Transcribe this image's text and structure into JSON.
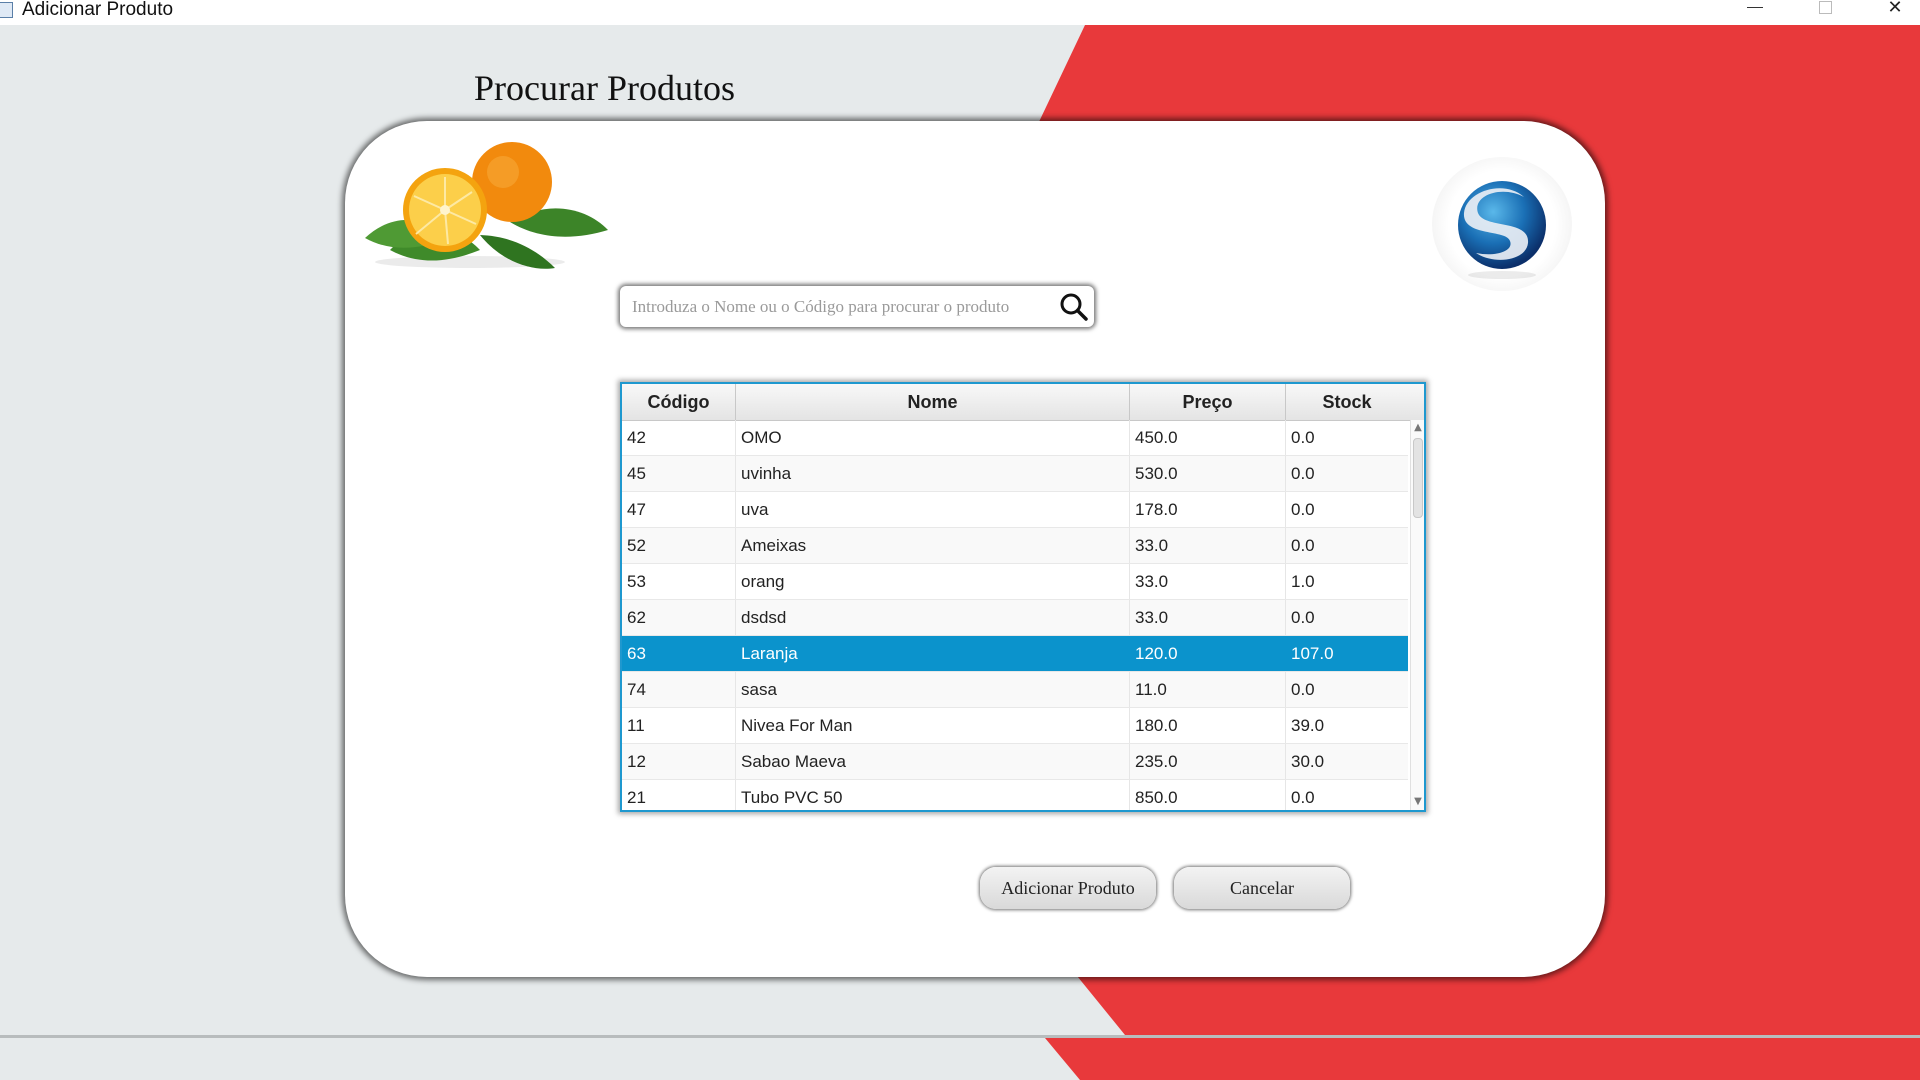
{
  "window": {
    "title": "Adicionar Produto"
  },
  "page": {
    "title": "Procurar Produtos"
  },
  "search": {
    "placeholder": "Introduza o Nome ou o Código para procurar o produto",
    "value": ""
  },
  "table": {
    "columns": [
      "Código",
      "Nome",
      "Preço",
      "Stock"
    ],
    "rows": [
      {
        "codigo": "42",
        "nome": "OMO",
        "preco": "450.0",
        "stock": "0.0"
      },
      {
        "codigo": "45",
        "nome": "uvinha",
        "preco": "530.0",
        "stock": "0.0"
      },
      {
        "codigo": "47",
        "nome": "uva",
        "preco": "178.0",
        "stock": "0.0"
      },
      {
        "codigo": "52",
        "nome": "Ameixas",
        "preco": "33.0",
        "stock": "0.0"
      },
      {
        "codigo": "53",
        "nome": "orang",
        "preco": "33.0",
        "stock": "1.0"
      },
      {
        "codigo": "62",
        "nome": "dsdsd",
        "preco": "33.0",
        "stock": "0.0"
      },
      {
        "codigo": "63",
        "nome": "Laranja",
        "preco": "120.0",
        "stock": "107.0",
        "selected": true
      },
      {
        "codigo": "74",
        "nome": "sasa",
        "preco": "11.0",
        "stock": "0.0"
      },
      {
        "codigo": "11",
        "nome": "Nivea For Man",
        "preco": "180.0",
        "stock": "39.0"
      },
      {
        "codigo": "12",
        "nome": "Sabao Maeva",
        "preco": "235.0",
        "stock": "30.0"
      },
      {
        "codigo": "21",
        "nome": "Tubo PVC 50",
        "preco": "850.0",
        "stock": "0.0"
      }
    ]
  },
  "buttons": {
    "add": "Adicionar Produto",
    "cancel": "Cancelar"
  },
  "colors": {
    "accent_red": "#e8393b",
    "light_bg": "#e6eaeb",
    "selection_blue": "#0b93cc",
    "table_border": "#1e98cf"
  },
  "icons": {
    "search": "search-icon",
    "decoration": "orange-fruit-image",
    "brand": "s-logo-sphere"
  }
}
